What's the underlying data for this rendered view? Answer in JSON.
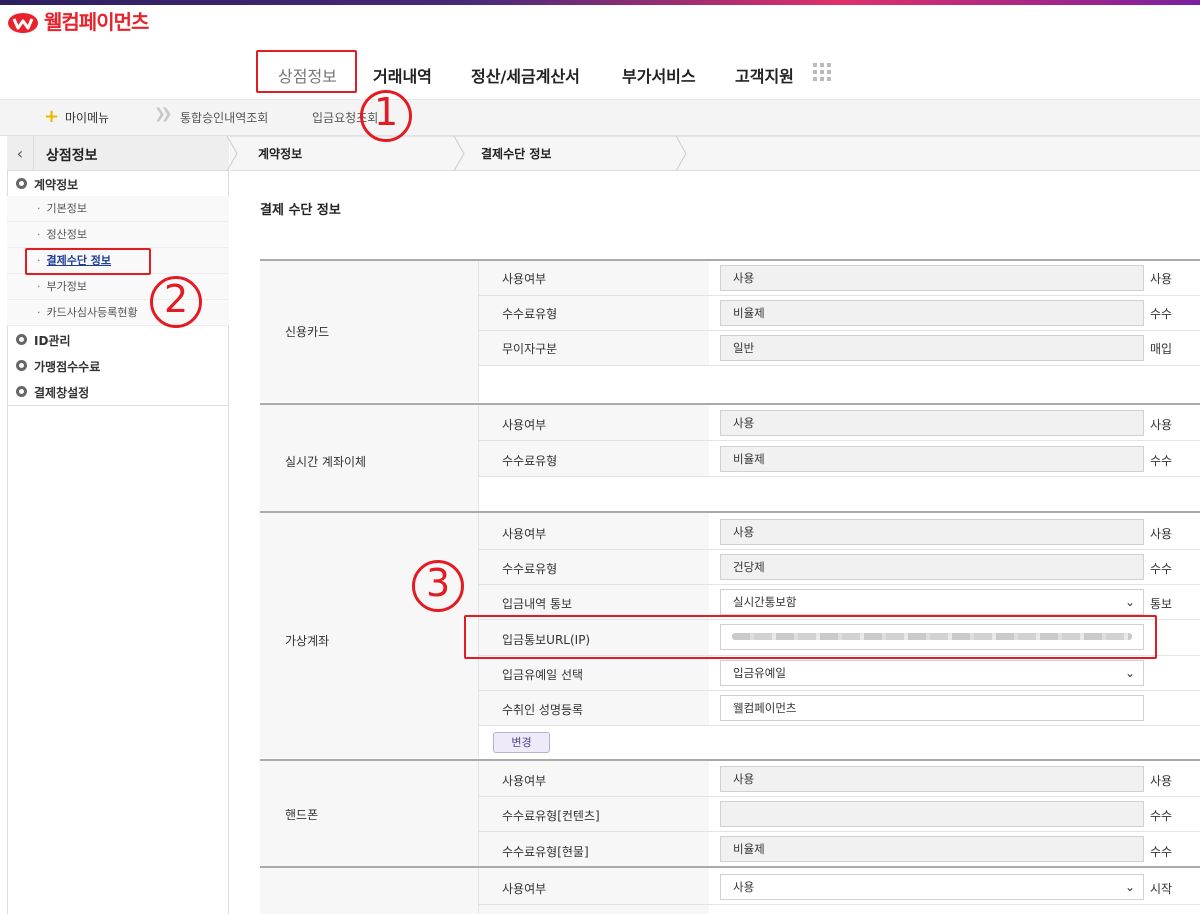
{
  "brand": {
    "name": "웰컴페이먼츠",
    "color": "#e8232c"
  },
  "gnb": {
    "items": [
      {
        "label": "상점정보",
        "active": true
      },
      {
        "label": "거래내역"
      },
      {
        "label": "정산/세금계산서"
      },
      {
        "label": "부가서비스"
      },
      {
        "label": "고객지원"
      }
    ]
  },
  "subbar": {
    "mymenu": "마이메뉴",
    "links": [
      "통합승인내역조회",
      "입금요청조회"
    ]
  },
  "sidebar": {
    "title": "상점정보",
    "groups": [
      {
        "label": "계약정보",
        "items": [
          "기본정보",
          "정산정보",
          "결제수단 정보",
          "부가정보",
          "카드사심사등록현황"
        ]
      },
      {
        "label": "ID관리"
      },
      {
        "label": "가맹점수수료"
      },
      {
        "label": "결제창설정"
      }
    ]
  },
  "breadcrumb": [
    "계약정보",
    "결제수단 정보"
  ],
  "section_title": "결제 수단 정보",
  "table": {
    "credit_card": {
      "label": "신용카드",
      "rows": [
        {
          "label": "사용여부",
          "value": "사용",
          "right": "사용"
        },
        {
          "label": "수수료유형",
          "value": "비율제",
          "right": "수수"
        },
        {
          "label": "무이자구분",
          "value": "일반",
          "right": "매입"
        }
      ]
    },
    "realtime_transfer": {
      "label": "실시간 계좌이체",
      "rows": [
        {
          "label": "사용여부",
          "value": "사용",
          "right": "사용"
        },
        {
          "label": "수수료유형",
          "value": "비율제",
          "right": "수수"
        }
      ]
    },
    "virtual_account": {
      "label": "가상계좌",
      "rows": [
        {
          "label": "사용여부",
          "value": "사용",
          "right": "사용"
        },
        {
          "label": "수수료유형",
          "value": "건당제",
          "right": "수수"
        },
        {
          "label": "입금내역 통보",
          "value": "실시간통보함",
          "right": "통보"
        },
        {
          "label": "입금통보URL(IP)",
          "value": ""
        },
        {
          "label": "입금유예일 선택",
          "value": "입금유예일"
        },
        {
          "label": "수취인 성명등록",
          "value": "웰컴페이먼츠"
        }
      ],
      "button": "변경"
    },
    "phone": {
      "label": "핸드폰",
      "rows": [
        {
          "label": "사용여부",
          "value": "사용",
          "right": "사용"
        },
        {
          "label": "수수료유형[컨텐츠]",
          "value": "",
          "right": "수수"
        },
        {
          "label": "수수료유형[현물]",
          "value": "비율제",
          "right": "수수"
        }
      ]
    },
    "next": {
      "rows": [
        {
          "label": "사용여부",
          "value": "사용",
          "right": "시작"
        }
      ]
    }
  },
  "annotations": {
    "one": "1",
    "two": "2",
    "three": "3"
  },
  "colors": {
    "highlight": "#e31b23",
    "active_link": "#1f3e96"
  }
}
